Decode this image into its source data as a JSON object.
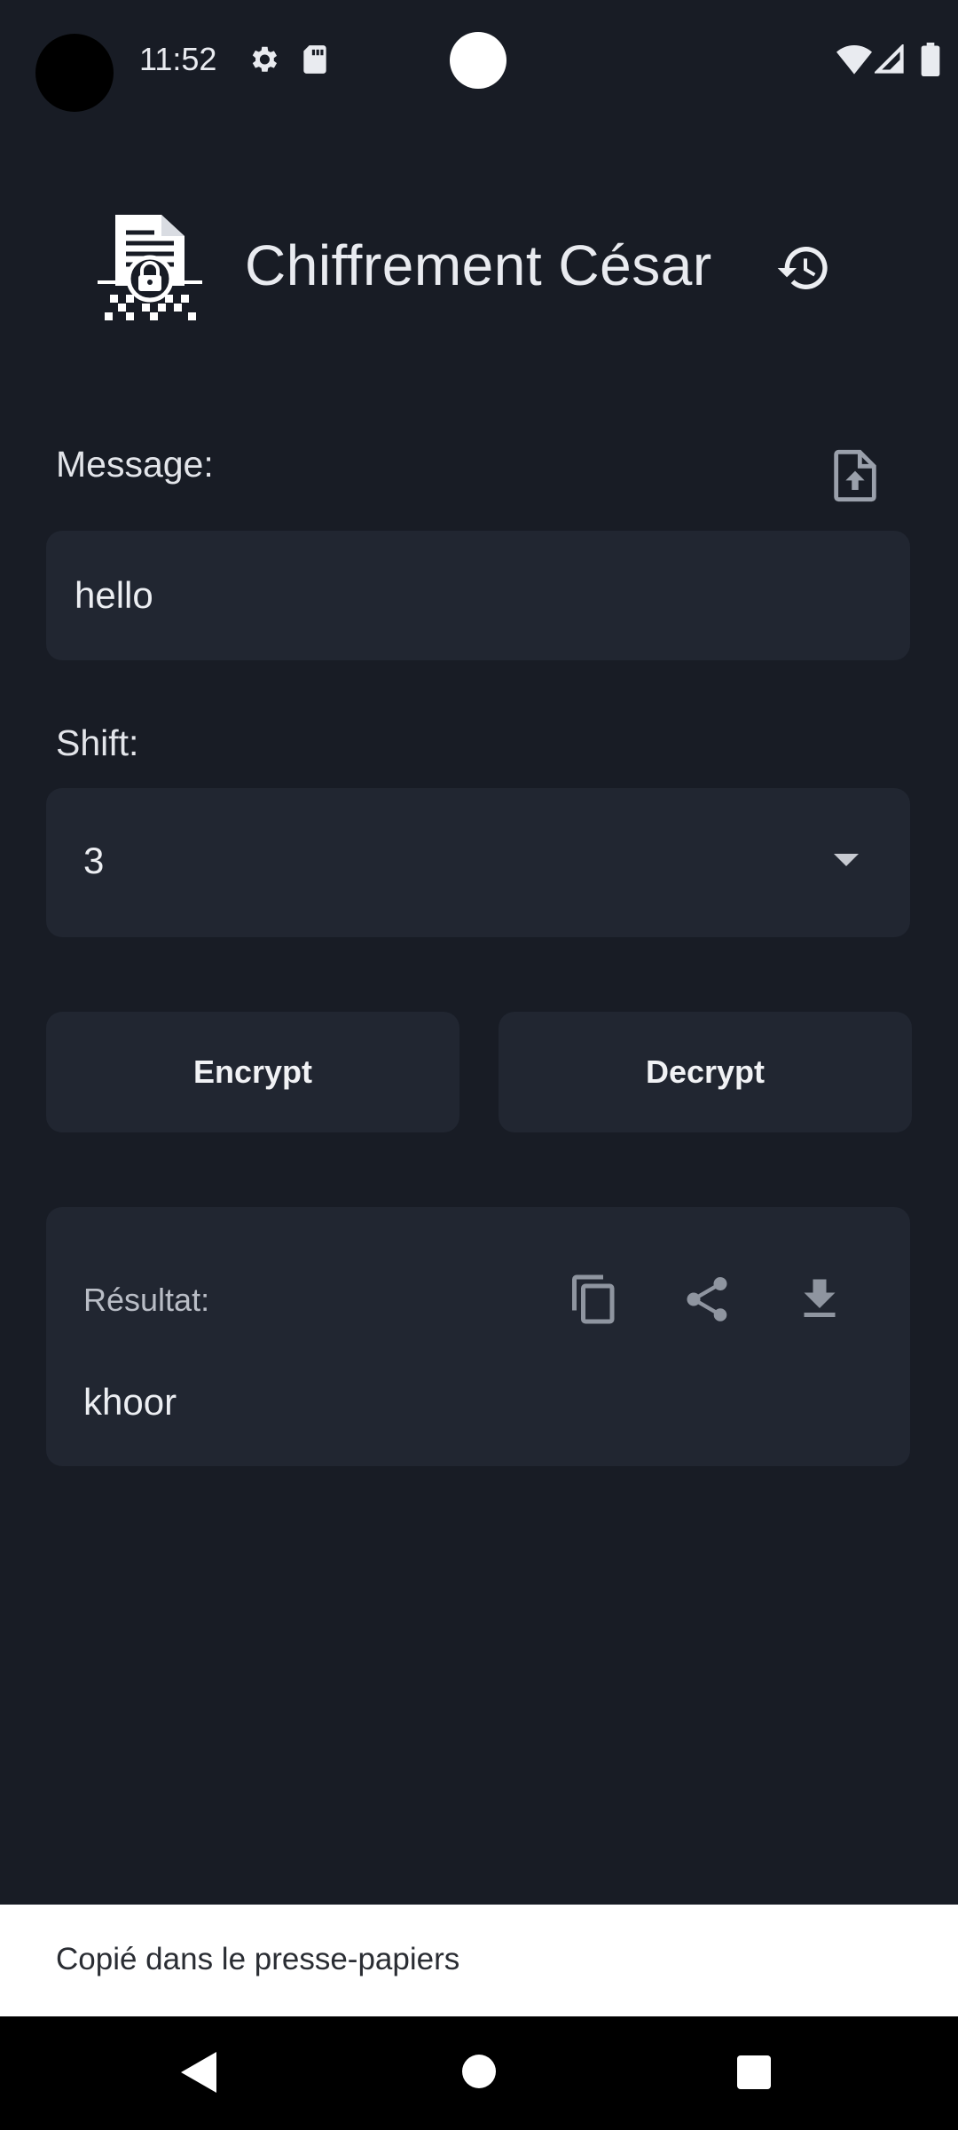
{
  "status_bar": {
    "time": "11:52",
    "icons": [
      "settings-icon",
      "sd-card-icon",
      "wifi-icon",
      "signal-icon",
      "battery-icon"
    ]
  },
  "header": {
    "title": "Chiffrement César",
    "logo_icon": "encrypted-document-icon",
    "history_icon": "history-icon"
  },
  "message": {
    "label": "Message:",
    "value": "hello",
    "upload_icon": "upload-file-icon"
  },
  "shift": {
    "label": "Shift:",
    "selected": "3"
  },
  "actions": {
    "encrypt_label": "Encrypt",
    "decrypt_label": "Decrypt"
  },
  "result": {
    "label": "Résultat:",
    "value": "khoor",
    "icons": [
      "copy-icon",
      "share-icon",
      "download-icon"
    ]
  },
  "snackbar": {
    "text": "Copié dans le presse-papiers"
  },
  "nav_bar": {
    "icons": [
      "back-icon",
      "home-icon",
      "recents-icon"
    ]
  },
  "colors": {
    "background": "#181c25",
    "surface": "#212631",
    "text": "#e9ebf0",
    "snackbar": "#ffffff"
  }
}
